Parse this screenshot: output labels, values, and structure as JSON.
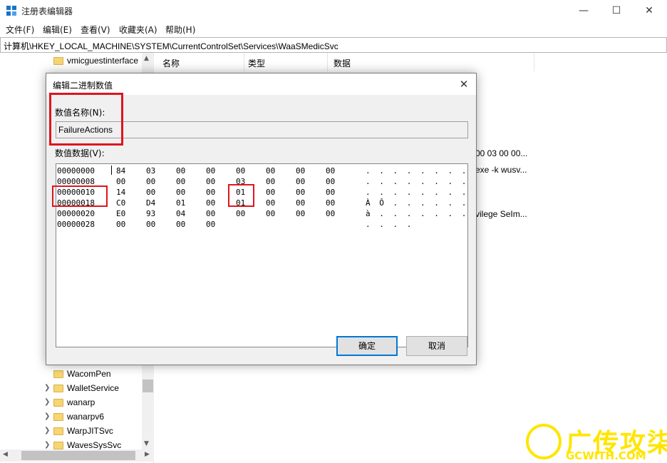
{
  "window": {
    "title": "注册表编辑器",
    "minimize": "—",
    "maximize": "☐",
    "close": "✕"
  },
  "menu": [
    "文件(F)",
    "编辑(E)",
    "查看(V)",
    "收藏夹(A)",
    "帮助(H)"
  ],
  "address": "计算机\\HKEY_LOCAL_MACHINE\\SYSTEM\\CurrentControlSet\\Services\\WaaSMedicSvc",
  "tree": {
    "top_items": [
      "vmicguestinterface",
      ""
    ],
    "bottom_items": [
      "WacomPen",
      "WalletService",
      "wanarp",
      "wanarpv6",
      "WarpJITSvc",
      "WavesSysSvc"
    ]
  },
  "list": {
    "columns": [
      "名称",
      "类型",
      "数据"
    ],
    "partial_texts": [
      "00 03 00 00...",
      "exe -k wusv...",
      "vilege SeIm..."
    ]
  },
  "dialog": {
    "title": "编辑二进制数值",
    "close": "✕",
    "name_label": "数值名称(N):",
    "name_value": "FailureActions",
    "data_label": "数值数据(V):",
    "hex_rows": [
      {
        "offset": "00000000",
        "bytes": [
          "84",
          "03",
          "00",
          "00",
          "00",
          "00",
          "00",
          "00"
        ],
        "ascii": ". . . . . . . ."
      },
      {
        "offset": "00000008",
        "bytes": [
          "00",
          "00",
          "00",
          "00",
          "03",
          "00",
          "00",
          "00"
        ],
        "ascii": ". . . . . . . ."
      },
      {
        "offset": "00000010",
        "bytes": [
          "14",
          "00",
          "00",
          "00",
          "01",
          "00",
          "00",
          "00"
        ],
        "ascii": ". . . . . . . ."
      },
      {
        "offset": "00000018",
        "bytes": [
          "C0",
          "D4",
          "01",
          "00",
          "01",
          "00",
          "00",
          "00"
        ],
        "ascii": "À Ô . . . . . ."
      },
      {
        "offset": "00000020",
        "bytes": [
          "E0",
          "93",
          "04",
          "00",
          "00",
          "00",
          "00",
          "00"
        ],
        "ascii": "à . . . . . . ."
      },
      {
        "offset": "00000028",
        "bytes": [
          "00",
          "00",
          "00",
          "00"
        ],
        "ascii": ". . . ."
      }
    ],
    "ok_label": "确定",
    "cancel_label": "取消"
  },
  "watermark": {
    "main": "广传攻柒",
    "sub": "GCWITH.COM"
  },
  "colors": {
    "highlight_red": "#e0141e",
    "watermark_yellow": "#ffe500",
    "accent_blue": "#0078d7"
  }
}
